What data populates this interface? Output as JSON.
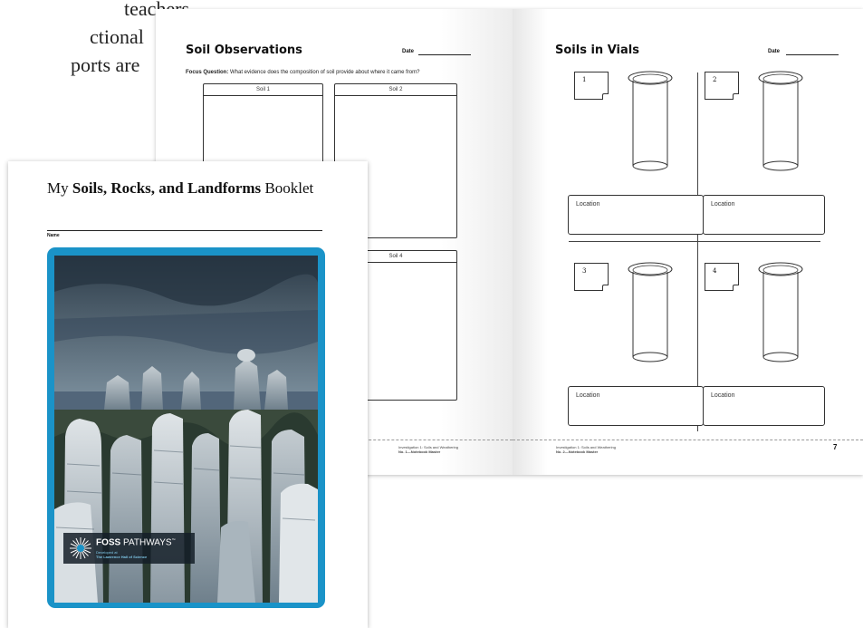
{
  "cut_text": {
    "line1": "teachers",
    "line2": "ctional",
    "line3": "ports are"
  },
  "spread": {
    "left": {
      "title": "Soil Observations",
      "date_label": "Date",
      "focus_label": "Focus Question:",
      "focus_text": "What evidence does the composition of soil provide about where it came from?",
      "boxes": [
        "Soil 1",
        "Soil 2",
        "Soil 4"
      ],
      "footer_line1": "Investigation 1: Soils and Weathering",
      "footer_line2": "No. 1—Notebook Master"
    },
    "right": {
      "title": "Soils in Vials",
      "date_label": "Date",
      "vial_numbers": [
        "1",
        "2",
        "3",
        "4"
      ],
      "location_label": "Location",
      "footer_line1": "Investigation 1: Soils and Weathering",
      "footer_line2": "No. 2—Notebook Master",
      "page_number": "7"
    }
  },
  "booklet": {
    "title_prefix": "My ",
    "title_bold": "Soils, Rocks, and Landforms",
    "title_suffix": " Booklet",
    "name_label": "Name",
    "badge_brand": "FOSS",
    "badge_name": " PATHWAYS",
    "badge_tm": "™",
    "badge_line1": "Developed at",
    "badge_line2": "The Lawrence Hall of Science"
  },
  "colors": {
    "frame_blue": "#1a93c8",
    "badge_text_blue": "#7fc8e8"
  }
}
